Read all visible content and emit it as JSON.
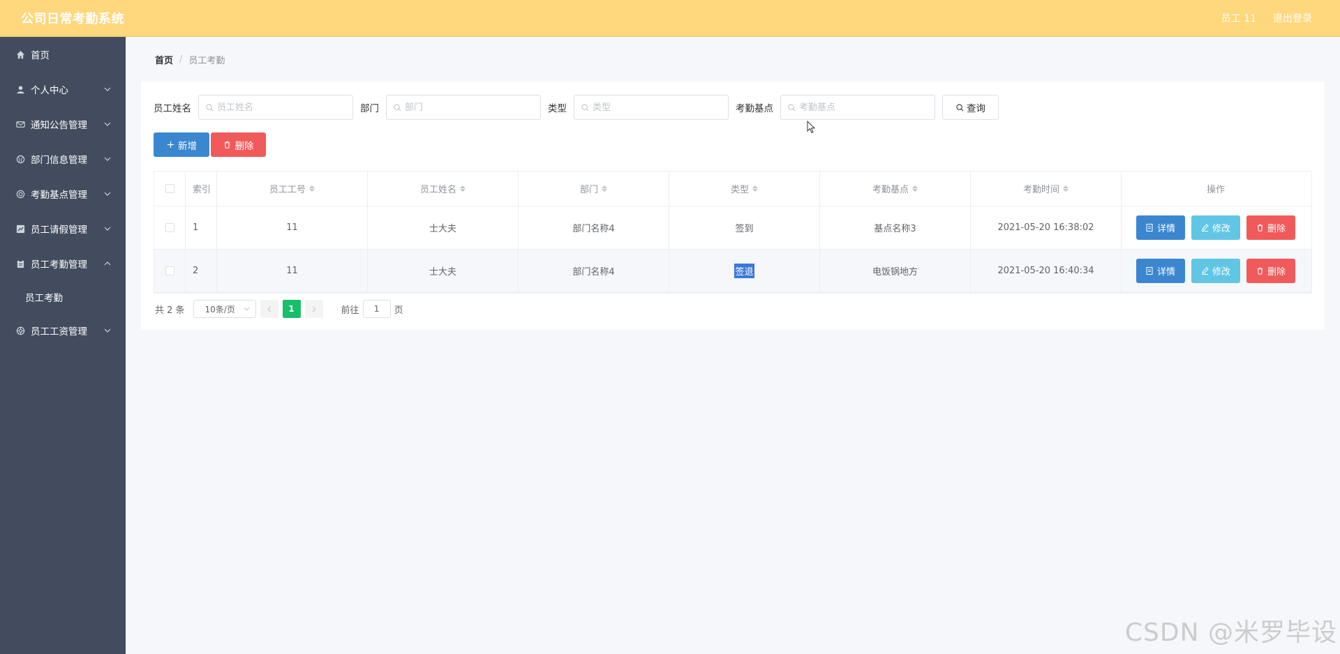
{
  "app": {
    "title": "公司日常考勤系统",
    "user_label": "员工 11",
    "logout_label": "退出登录"
  },
  "sidebar": {
    "items": [
      {
        "label": "首页",
        "icon": "home-icon",
        "has_children": false
      },
      {
        "label": "个人中心",
        "icon": "user-icon",
        "has_children": true
      },
      {
        "label": "通知公告管理",
        "icon": "message-icon",
        "has_children": true
      },
      {
        "label": "部门信息管理",
        "icon": "basketball-icon",
        "has_children": true
      },
      {
        "label": "考勤基点管理",
        "icon": "target-icon",
        "has_children": true
      },
      {
        "label": "员工请假管理",
        "icon": "chart-icon",
        "has_children": true
      },
      {
        "label": "员工考勤管理",
        "icon": "clipboard-icon",
        "has_children": true,
        "expanded": true
      },
      {
        "label": "员工工资管理",
        "icon": "help-circle-icon",
        "has_children": true
      }
    ],
    "submenu_active": "员工考勤"
  },
  "breadcrumb": {
    "home": "首页",
    "separator": "/",
    "current": "员工考勤"
  },
  "search": {
    "fields": [
      {
        "label": "员工姓名",
        "placeholder": "员工姓名"
      },
      {
        "label": "部门",
        "placeholder": "部门"
      },
      {
        "label": "类型",
        "placeholder": "类型"
      },
      {
        "label": "考勤基点",
        "placeholder": "考勤基点"
      }
    ],
    "query_label": "查询"
  },
  "actions": {
    "add_label": "新增",
    "delete_label": "删除"
  },
  "table": {
    "columns": [
      "索引",
      "员工工号",
      "员工姓名",
      "部门",
      "类型",
      "考勤基点",
      "考勤时间",
      "操作"
    ],
    "rows": [
      {
        "index": "1",
        "emp_no": "11",
        "name": "士大夫",
        "dept": "部门名称4",
        "type": "签到",
        "base": "基点名称3",
        "time": "2021-05-20 16:38:02"
      },
      {
        "index": "2",
        "emp_no": "11",
        "name": "士大夫",
        "dept": "部门名称4",
        "type": "签退",
        "base": "电饭锅地方",
        "time": "2021-05-20 16:40:34"
      }
    ],
    "op_labels": {
      "detail": "详情",
      "edit": "修改",
      "delete": "删除"
    }
  },
  "pagination": {
    "total_text": "共 2 条",
    "page_size": "10条/页",
    "current_page": "1",
    "goto_prefix": "前往",
    "goto_value": "1",
    "goto_suffix": "页"
  },
  "watermark": "CSDN @米罗毕设",
  "colors": {
    "header": "#ffd77c",
    "sidebar": "#424c5e",
    "primary": "#3a87d0",
    "danger": "#f15a5a",
    "info": "#61c6e4",
    "page_active": "#19be6b"
  }
}
